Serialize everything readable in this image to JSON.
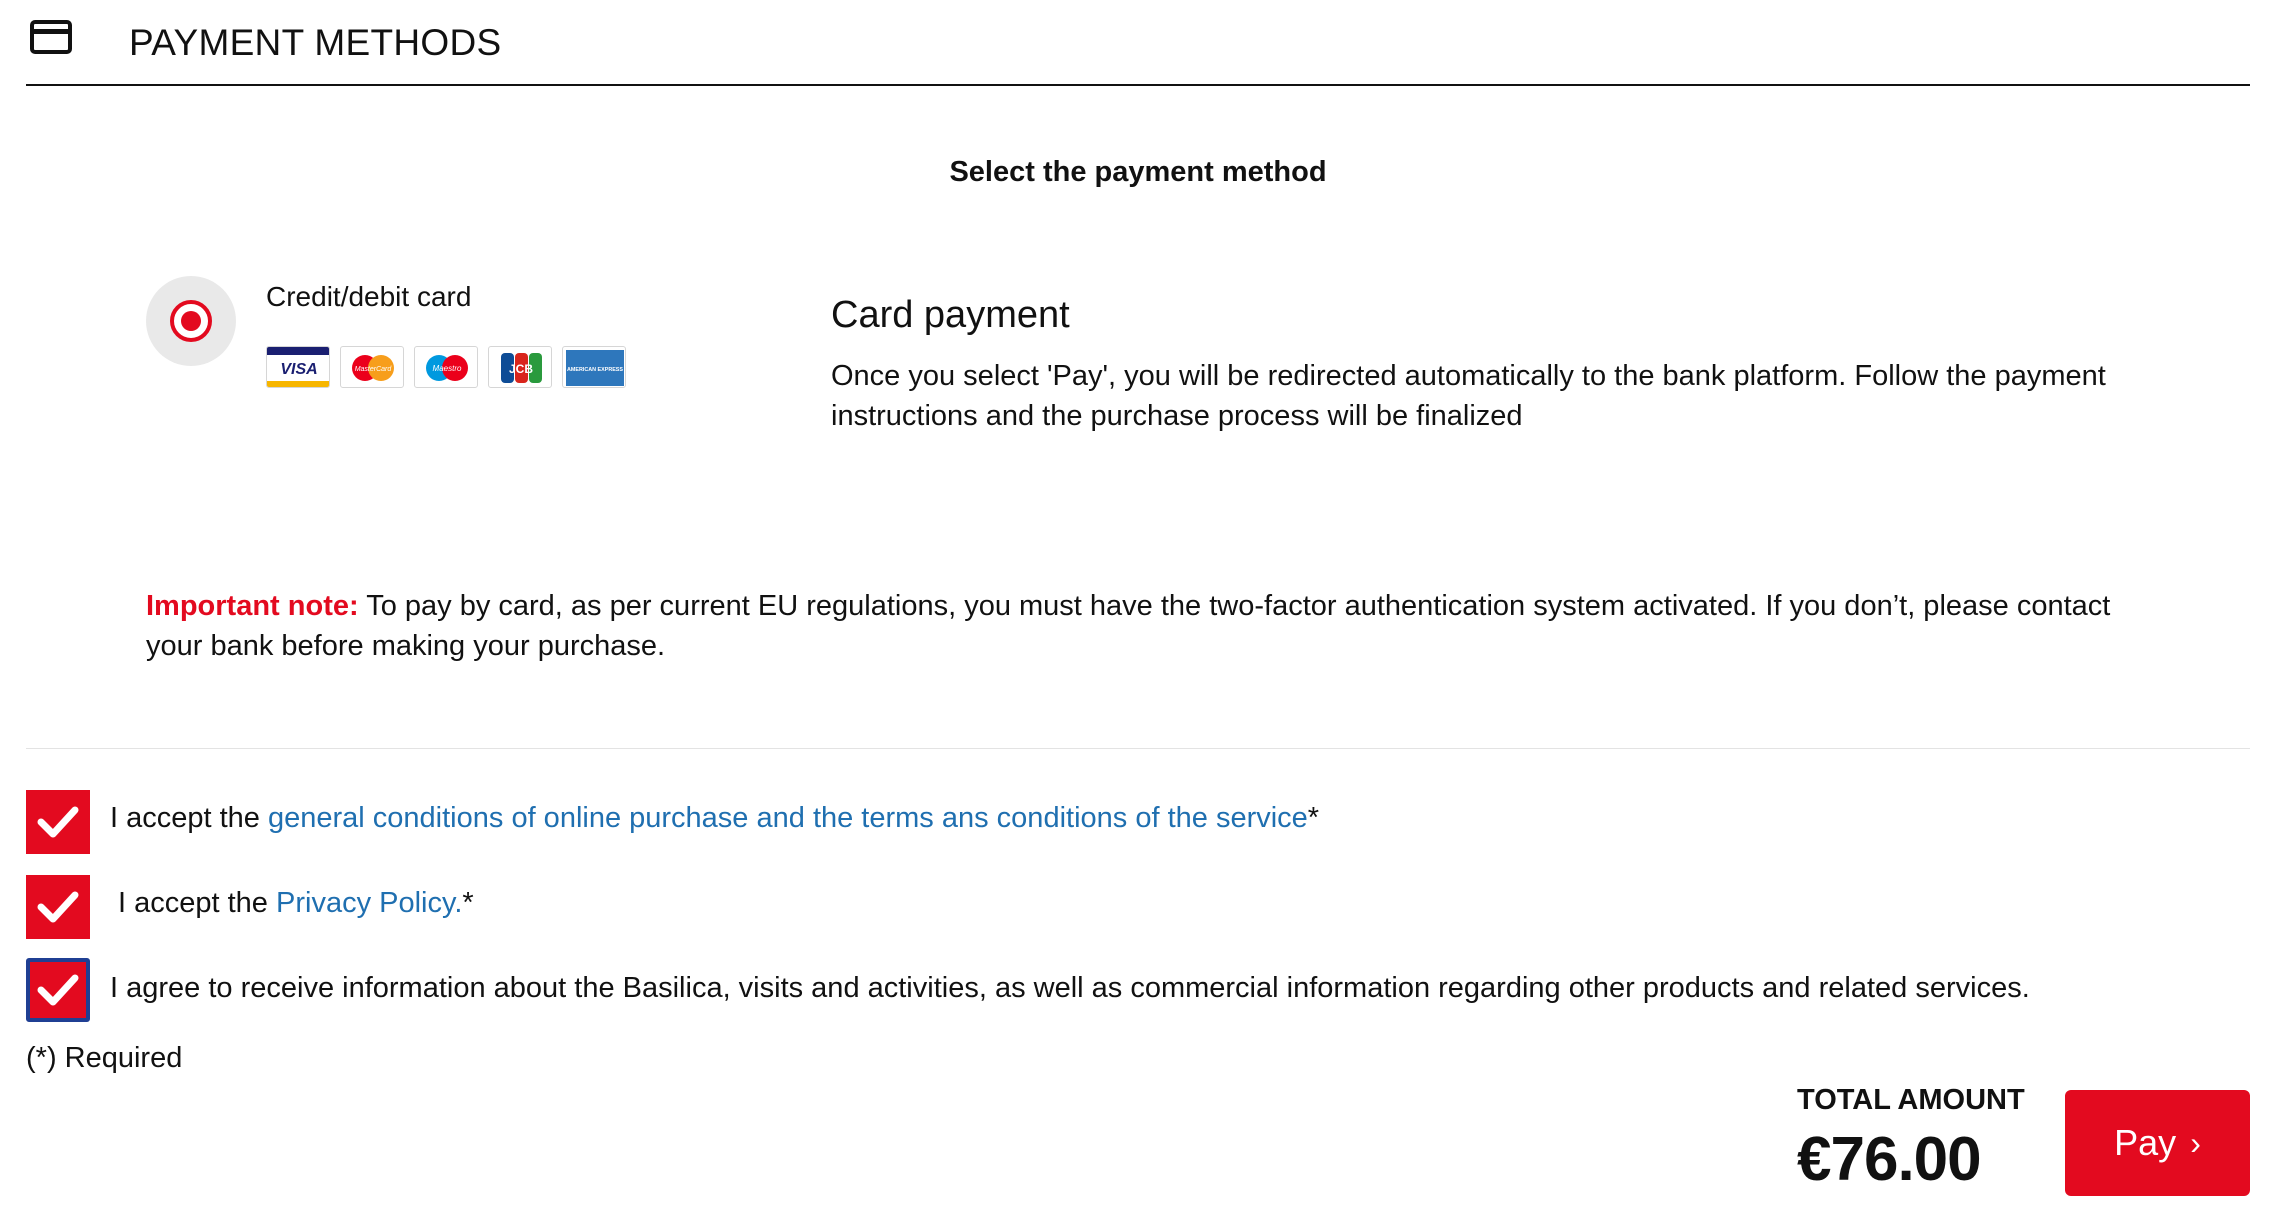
{
  "header": {
    "title": "PAYMENT METHODS",
    "icon": "credit-card-icon"
  },
  "subtitle": "Select the payment method",
  "payment_option": {
    "label": "Credit/debit card",
    "selected": true,
    "logos": [
      {
        "name": "visa-logo",
        "text": "VISA"
      },
      {
        "name": "mastercard-logo",
        "text": "MasterCard"
      },
      {
        "name": "maestro-logo",
        "text": "Maestro"
      },
      {
        "name": "jcb-logo",
        "text": "JCB"
      },
      {
        "name": "amex-logo",
        "text": "AMERICAN EXPRESS"
      }
    ]
  },
  "card_info": {
    "title": "Card payment",
    "description": "Once you select 'Pay', you will be redirected automatically to the bank platform. Follow the payment instructions and the purchase process will be finalized"
  },
  "note": {
    "label": "Important note:",
    "text": " To pay by card, as per current EU regulations, you must have the two-factor authentication system activated. If you don’t, please contact your bank before making your purchase."
  },
  "consents": [
    {
      "prefix": "I accept the ",
      "link": "general conditions of online purchase and the terms ans conditions of the service",
      "suffix": "*",
      "checked": true
    },
    {
      "prefix": "I accept the ",
      "link": "Privacy Policy.",
      "suffix": "*",
      "checked": true
    },
    {
      "prefix": "I agree to receive information about the Basilica, visits and activities, as well as commercial information regarding other products and related services.",
      "link": "",
      "suffix": "",
      "checked": true
    }
  ],
  "required_note": "(*) Required",
  "total": {
    "label": "TOTAL AMOUNT",
    "value": "€76.00"
  },
  "pay_button": {
    "label": "Pay",
    "chevron": "›"
  },
  "colors": {
    "accent": "#e30a1f",
    "link": "#1f6fb0",
    "focus_border": "#1f3f93",
    "text": "#111111"
  }
}
